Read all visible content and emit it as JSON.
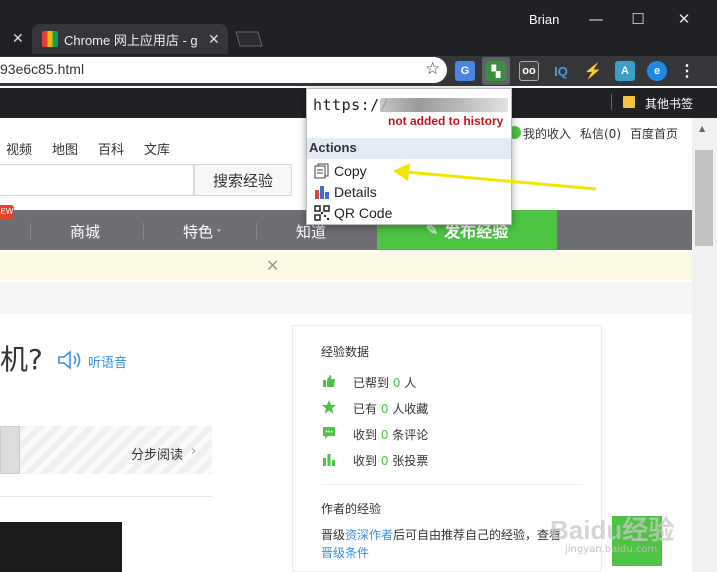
{
  "window": {
    "user": "Brian",
    "tabs": [
      {
        "label": ""
      },
      {
        "label": "Chrome 网上应用店 - g"
      }
    ]
  },
  "omnibox": {
    "url": "93e6c85.html"
  },
  "bookmarks": {
    "other_label": "其他书签"
  },
  "popup": {
    "short_url": "https://",
    "status": "not added to history",
    "section": "Actions",
    "items": [
      {
        "label": "Copy",
        "icon": "copy-icon"
      },
      {
        "label": "Details",
        "icon": "bar-chart-icon"
      },
      {
        "label": "QR Code",
        "icon": "qr-code-icon"
      }
    ]
  },
  "page": {
    "topnav": [
      "视频",
      "地图",
      "百科",
      "文库"
    ],
    "right_links": {
      "inbox": "我的收入",
      "messages": "私信(0)",
      "home": "百度首页"
    },
    "search_button": "搜索经验",
    "nav": [
      "商城",
      "特色",
      "知道"
    ],
    "new_badge": "EW",
    "publish": "发布经验",
    "question_tail": "机?",
    "listen": "听语音",
    "step_read": "分步阅读",
    "stats_title": "经验数据",
    "stats": [
      {
        "pre": "已帮到 ",
        "num": "0",
        "post": " 人"
      },
      {
        "pre": "已有 ",
        "num": "0",
        "post": " 人收藏"
      },
      {
        "pre": "收到 ",
        "num": "0",
        "post": " 条评论"
      },
      {
        "pre": "收到 ",
        "num": "0",
        "post": " 张投票"
      }
    ],
    "author_title": "作者的经验",
    "author_pre": "晋级",
    "author_link": "资深作者",
    "author_post": "后可自由推荐自己的经验，查看",
    "author_cond": "晋级条件",
    "watermark": "Baidu经验",
    "watermark_sub": "jingyan.baidu.com"
  },
  "colors": {
    "accent_green": "#4dc443",
    "link_blue": "#3a8ee6",
    "status_red": "#c0161b",
    "arrow_yellow": "#f2e600"
  }
}
